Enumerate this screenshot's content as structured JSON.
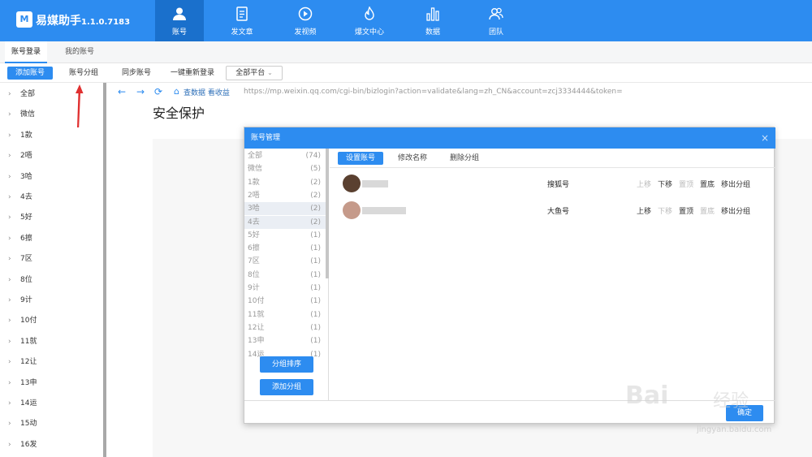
{
  "app": {
    "logo_text": "M",
    "name": "易媒助手",
    "version": "1.1.0.7183"
  },
  "nav": [
    {
      "label": "账号",
      "icon": "user-icon",
      "active": true
    },
    {
      "label": "发文章",
      "icon": "document-icon",
      "active": false
    },
    {
      "label": "发视频",
      "icon": "play-icon",
      "active": false
    },
    {
      "label": "爆文中心",
      "icon": "fire-icon",
      "active": false
    },
    {
      "label": "数据",
      "icon": "bar-chart-icon",
      "active": false
    },
    {
      "label": "团队",
      "icon": "team-icon",
      "active": false
    }
  ],
  "tabs": [
    {
      "label": "账号登录",
      "active": true
    },
    {
      "label": "我的账号",
      "active": false
    }
  ],
  "toolbar": {
    "add_account": "添加账号",
    "account_group": "账号分组",
    "sync_account": "同步账号",
    "relogin_all": "一键重新登录",
    "platform_select": "全部平台"
  },
  "sidebar": {
    "items": [
      "全部",
      "微信",
      "1款",
      "2唔",
      "3哈",
      "4去",
      "5好",
      "6擦",
      "7区",
      "8位",
      "9计",
      "10付",
      "11就",
      "12让",
      "13申",
      "14运",
      "15动",
      "16发"
    ]
  },
  "addressbar": {
    "check_data": "查数据",
    "view_income": "看收益",
    "url": "https://mp.weixin.qq.com/cgi-bin/bizlogin?action=validate&lang=zh_CN&account=zcj3334444&token="
  },
  "page": {
    "heading": "安全保护"
  },
  "modal": {
    "title": "账号管理",
    "close": "×",
    "groups": [
      {
        "name": "全部",
        "count": "(74)"
      },
      {
        "name": "微信",
        "count": "(5)"
      },
      {
        "name": "1款",
        "count": "(2)"
      },
      {
        "name": "2唔",
        "count": "(2)"
      },
      {
        "name": "3哈",
        "count": "(2)"
      },
      {
        "name": "4去",
        "count": "(2)"
      },
      {
        "name": "5好",
        "count": "(1)"
      },
      {
        "name": "6擦",
        "count": "(1)"
      },
      {
        "name": "7区",
        "count": "(1)"
      },
      {
        "name": "8位",
        "count": "(1)"
      },
      {
        "name": "9计",
        "count": "(1)"
      },
      {
        "name": "10付",
        "count": "(1)"
      },
      {
        "name": "11就",
        "count": "(1)"
      },
      {
        "name": "12让",
        "count": "(1)"
      },
      {
        "name": "13申",
        "count": "(1)"
      },
      {
        "name": "14运",
        "count": "(1)"
      }
    ],
    "sort_groups": "分组排序",
    "add_group": "添加分组",
    "tabs": [
      "设置账号",
      "修改名称",
      "删除分组"
    ],
    "accounts": [
      {
        "platform": "搜狐号",
        "actions": [
          "上移",
          "下移",
          "置顶",
          "置底",
          "移出分组"
        ]
      },
      {
        "platform": "大鱼号",
        "actions": [
          "上移",
          "下移",
          "置顶",
          "置底",
          "移出分组"
        ]
      }
    ],
    "ok": "确定"
  },
  "watermark": {
    "line1": "Bai",
    "line2": "经验",
    "url": "jingyan.baidu.com"
  },
  "colors": {
    "primary": "#2d8cf0",
    "nav_active": "#1a70cc"
  }
}
